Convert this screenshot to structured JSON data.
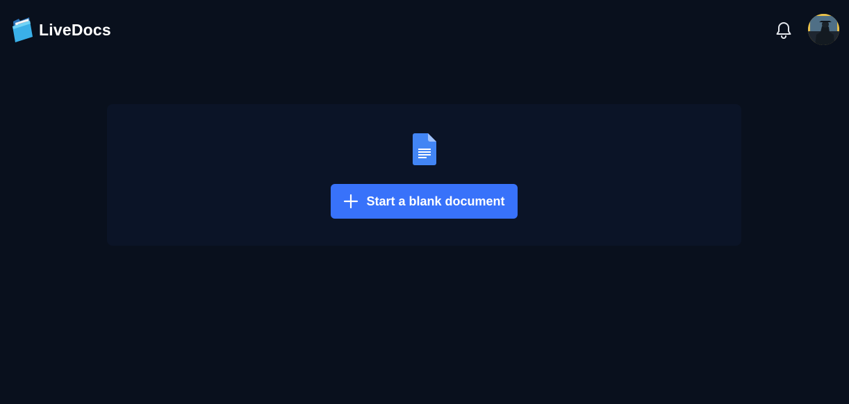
{
  "header": {
    "app_name": "LiveDocs",
    "logo_icon": "folder-logo-icon",
    "notifications_icon": "bell-icon",
    "avatar_icon": "user-avatar"
  },
  "empty_state": {
    "document_icon": "document-icon",
    "start_button_label": "Start a blank document",
    "start_button_icon": "plus-icon"
  },
  "colors": {
    "background": "#09101d",
    "card_background": "#0b1427",
    "accent": "#3872fa",
    "text": "#ffffff"
  }
}
